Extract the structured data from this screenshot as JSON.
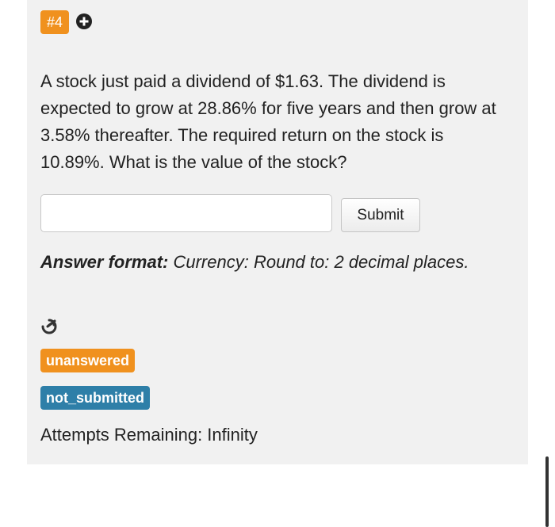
{
  "question": {
    "number": "#4",
    "text": "A stock just paid a dividend of $1.63. The dividend is expected to grow at 28.86% for five years and then grow at 3.58% thereafter. The required return on the stock is 10.89%. What is the value of the stock?"
  },
  "answer": {
    "input_value": "",
    "input_placeholder": "",
    "submit_label": "Submit"
  },
  "answer_format": {
    "label": "Answer format:",
    "value": "Currency: Round to: 2 decimal places."
  },
  "status": {
    "answer_state": "unanswered",
    "submission_state": "not_submitted",
    "attempts_label": "Attempts Remaining: Infinity"
  },
  "icons": {
    "expand": "plus-circle-icon",
    "share": "share-arrow-icon"
  },
  "colors": {
    "orange": "#f0911e",
    "blue": "#2e7fa8",
    "panel_bg": "#f1f1f1"
  }
}
